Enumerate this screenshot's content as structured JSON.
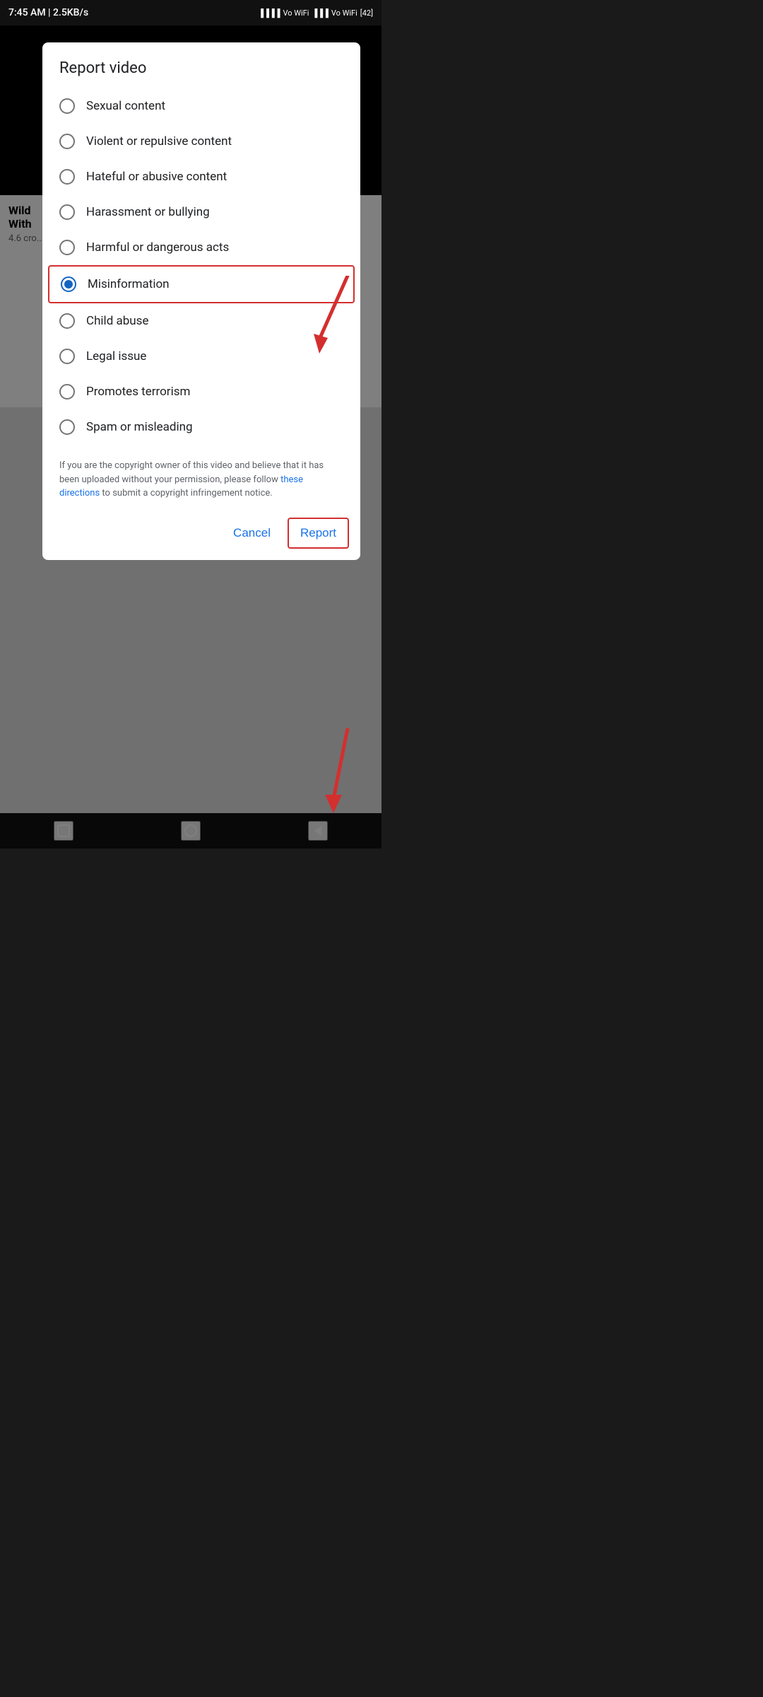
{
  "statusBar": {
    "time": "7:45 AM | 2.5KB/s",
    "battery": "42"
  },
  "dialog": {
    "title": "Report video",
    "options": [
      {
        "id": "sexual",
        "label": "Sexual content",
        "selected": false
      },
      {
        "id": "violent",
        "label": "Violent or repulsive content",
        "selected": false
      },
      {
        "id": "hateful",
        "label": "Hateful or abusive content",
        "selected": false
      },
      {
        "id": "harassment",
        "label": "Harassment or bullying",
        "selected": false
      },
      {
        "id": "harmful",
        "label": "Harmful or dangerous acts",
        "selected": false
      },
      {
        "id": "misinformation",
        "label": "Misinformation",
        "selected": true
      },
      {
        "id": "child",
        "label": "Child abuse",
        "selected": false
      },
      {
        "id": "legal",
        "label": "Legal issue",
        "selected": false
      },
      {
        "id": "terrorism",
        "label": "Promotes terrorism",
        "selected": false
      },
      {
        "id": "spam",
        "label": "Spam or misleading",
        "selected": false
      }
    ],
    "copyright_text_1": "If you are the copyright owner of this video and believe that it has been uploaded without your permission, please follow ",
    "copyright_link": "these directions",
    "copyright_text_2": " to submit a copyright infringement notice.",
    "cancel_label": "Cancel",
    "report_label": "Report"
  },
  "navBar": {
    "square": "▢",
    "circle": "○",
    "back": "◁"
  }
}
